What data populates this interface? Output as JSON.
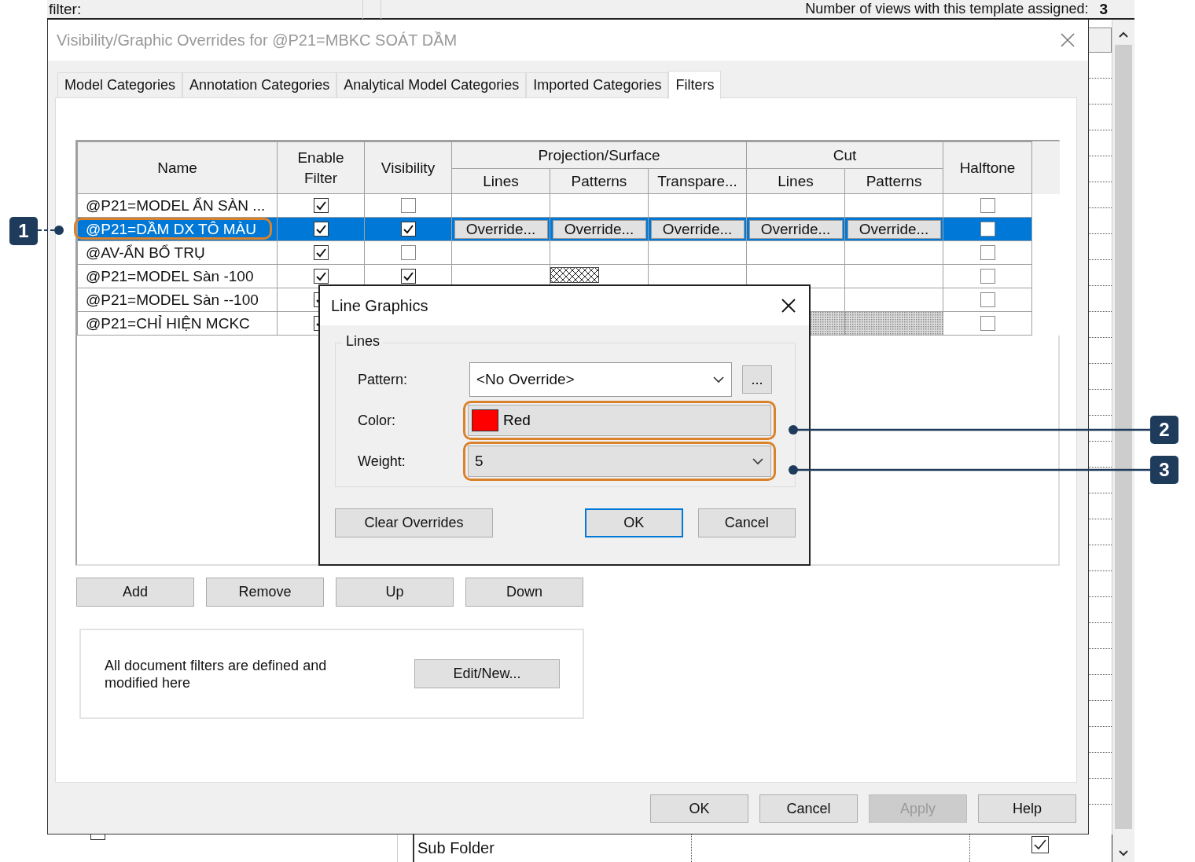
{
  "background": {
    "filter_label": "filter:",
    "views_label": "Number of views with this template assigned:",
    "views_count": "3",
    "left_checkbox": {
      "checked": false
    },
    "bottom_row": {
      "name": "Sub Folder",
      "checked": true
    }
  },
  "dialog": {
    "title": "Visibility/Graphic Overrides for @P21=MBKC SOÁT DẦM",
    "tabs": [
      {
        "label": "Model Categories",
        "selected": false
      },
      {
        "label": "Annotation Categories",
        "selected": false
      },
      {
        "label": "Analytical Model Categories",
        "selected": false
      },
      {
        "label": "Imported Categories",
        "selected": false
      },
      {
        "label": "Filters",
        "selected": true
      }
    ],
    "table": {
      "header": {
        "name": "Name",
        "enable": "Enable Filter",
        "visibility": "Visibility",
        "groups": [
          {
            "label": "Projection/Surface",
            "columns": [
              "Lines",
              "Patterns",
              "Transpare..."
            ]
          },
          {
            "label": "Cut",
            "columns": [
              "Lines",
              "Patterns"
            ]
          }
        ],
        "halftone": "Halftone"
      },
      "rows": [
        {
          "name": "@P21=MODEL ẨN SÀN ...",
          "selected": false,
          "enable": true,
          "visibility": false,
          "halftone": false
        },
        {
          "name": "@P21=DẦM DX TÔ MÀU",
          "selected": true,
          "enable": true,
          "visibility": true,
          "halftone": false,
          "overrides": [
            "Override...",
            "Override...",
            "Override...",
            "Override...",
            "Override..."
          ]
        },
        {
          "name": "@AV-ẨN BỔ TRỤ",
          "selected": false,
          "enable": true,
          "visibility": false,
          "halftone": false
        },
        {
          "name": "@P21=MODEL Sàn -100",
          "selected": false,
          "enable": true,
          "visibility": true,
          "halftone": false,
          "pattern_override": true
        },
        {
          "name": "@P21=MODEL Sàn --100",
          "selected": false,
          "enable": true,
          "halftone": false
        },
        {
          "name": "@P21=CHỈ HIỆN MCKC",
          "selected": false,
          "enable": true,
          "halftone": false,
          "cut_pattern_override": true
        }
      ]
    },
    "row_buttons": [
      "Add",
      "Remove",
      "Up",
      "Down"
    ],
    "info": {
      "text": "All document filters are defined and modified here",
      "button": "Edit/New..."
    },
    "buttons": [
      {
        "label": "OK",
        "disabled": false
      },
      {
        "label": "Cancel",
        "disabled": false
      },
      {
        "label": "Apply",
        "disabled": true
      },
      {
        "label": "Help",
        "disabled": false
      }
    ]
  },
  "line_graphics": {
    "title": "Line Graphics",
    "group": "Lines",
    "pattern_label": "Pattern:",
    "pattern_value": "<No Override>",
    "browse": "...",
    "color_label": "Color:",
    "color_name": "Red",
    "color": "#ff0000",
    "weight_label": "Weight:",
    "weight_value": "5",
    "buttons": [
      {
        "label": "Clear Overrides",
        "default": false
      },
      {
        "label": "OK",
        "default": true
      },
      {
        "label": "Cancel",
        "default": false
      }
    ]
  },
  "callouts": [
    {
      "label": "1"
    },
    {
      "label": "2"
    },
    {
      "label": "3"
    }
  ]
}
